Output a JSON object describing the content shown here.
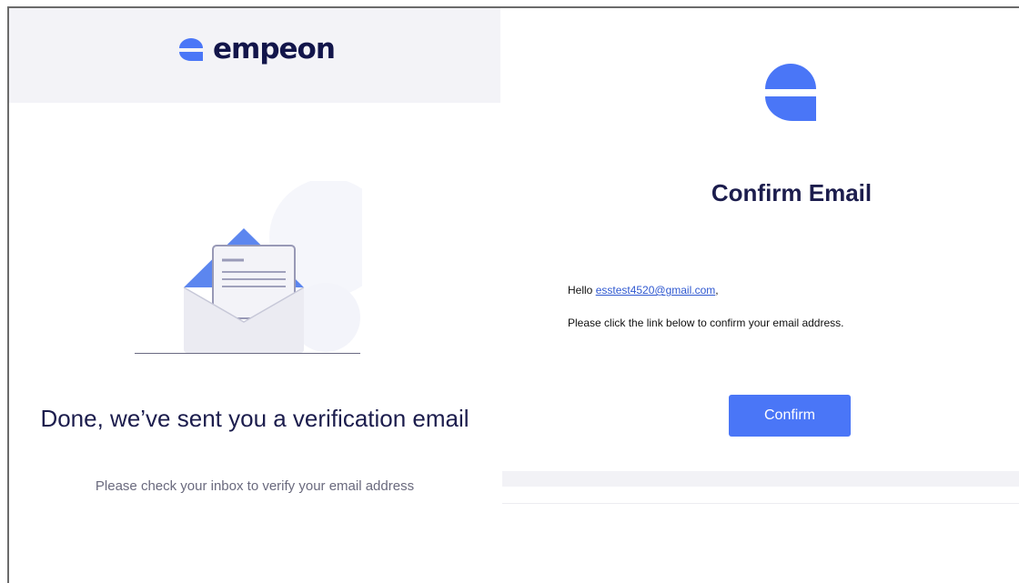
{
  "brand": {
    "name": "empeon",
    "color": "#4a76f7",
    "text_color": "#12154a"
  },
  "left": {
    "title": "Done, we’ve sent you a verification email",
    "subtitle": "Please check your inbox to verify your email address"
  },
  "right": {
    "title": "Confirm Email",
    "greeting": "Hello ",
    "email": "esstest4520@gmail.com",
    "greeting_suffix": ",",
    "instruction": "Please click the link below to confirm your email address.",
    "confirm_label": "Confirm"
  },
  "icons": [
    "empeon-logo-icon",
    "envelope-icon",
    "empeon-logo-large-icon"
  ]
}
